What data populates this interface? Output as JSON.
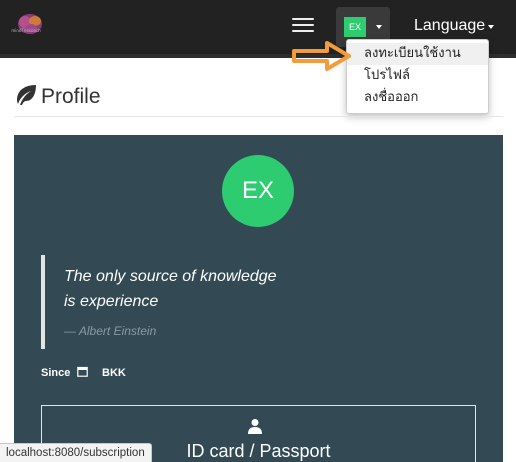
{
  "navbar": {
    "logo_text": "mindThecoach",
    "user_avatar_text": "EX",
    "language_label": "Language",
    "icons": {
      "menu": "hamburger-menu-icon",
      "dropdown": "caret-down-icon"
    }
  },
  "user_menu": {
    "items": [
      {
        "label": "ลงทะเบียนใช้งาน"
      },
      {
        "label": "โปรไฟล์"
      },
      {
        "label": "ลงชื่อออก"
      }
    ]
  },
  "annotation": {
    "icon": "orange-arrow-icon",
    "color": "#f39c3c"
  },
  "page": {
    "title": "Profile",
    "title_icon": "leaf-icon"
  },
  "profile_card": {
    "avatar_text": "EX",
    "quote": {
      "line1": "The only source of knowledge",
      "line2": "is experience",
      "author": "— Albert Einstein"
    },
    "since_label": "Since",
    "since_value": "BKK",
    "id_section": {
      "title": "ID card / Passport",
      "icon": "person-icon"
    }
  },
  "status_bar": {
    "url": "localhost:8080/subscription"
  },
  "colors": {
    "navbar": "#222222",
    "panel": "#334a54",
    "avatar": "#2ecc71",
    "arrow": "#f39c3c"
  }
}
